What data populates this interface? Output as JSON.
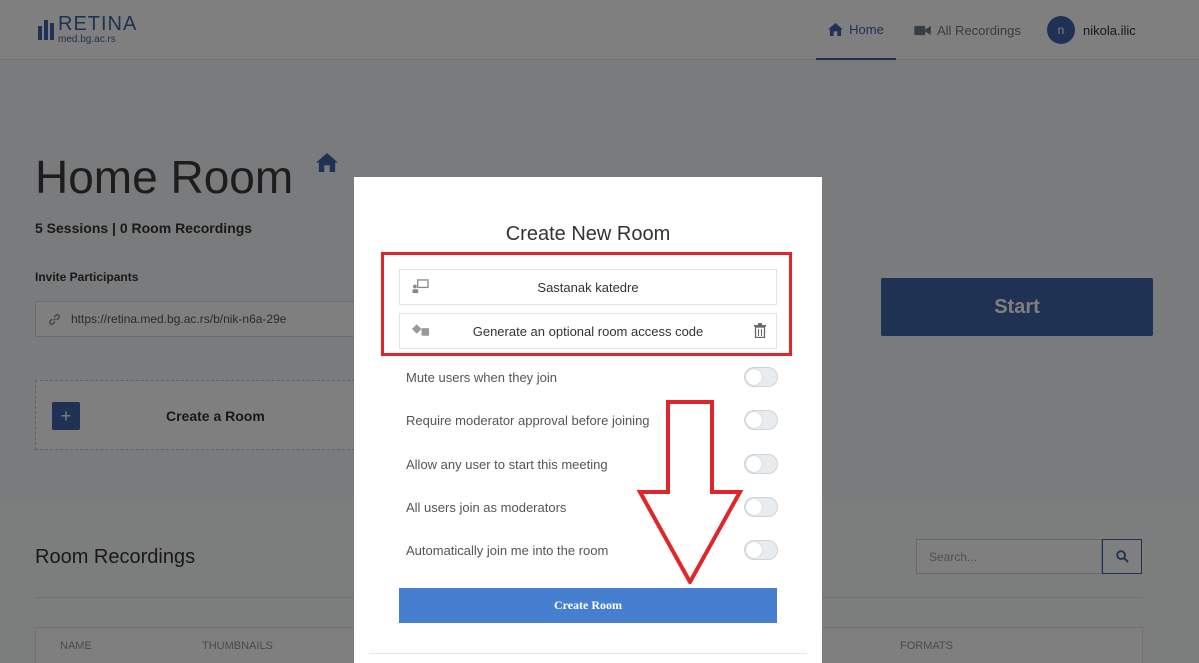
{
  "navbar": {
    "logo_title": "RETINA",
    "logo_sub": "med.bg.ac.rs",
    "home_label": "Home",
    "recordings_label": "All Recordings",
    "avatar_initial": "n",
    "username": "nikola.ilic"
  },
  "page": {
    "title": "Home Room",
    "sessions": "5 Sessions | 0 Room Recordings",
    "invite_label": "Invite Participants",
    "invite_url": "https://retina.med.bg.ac.rs/b/nik-n6a-29e",
    "create_room_card": "Create a Room",
    "plus": "+",
    "start_button": "Start"
  },
  "recordings": {
    "title": "Room Recordings",
    "search_placeholder": "Search...",
    "columns": [
      "NAME",
      "THUMBNAILS",
      "FORMATS"
    ]
  },
  "modal": {
    "title": "Create New Room",
    "room_name_value": "Sastanak katedre",
    "access_code_text": "Generate an optional room access code",
    "options": [
      {
        "label": "Mute users when they join",
        "enabled": false
      },
      {
        "label": "Require moderator approval before joining",
        "enabled": false
      },
      {
        "label": "Allow any user to start this meeting",
        "enabled": false
      },
      {
        "label": "All users join as moderators",
        "enabled": false
      },
      {
        "label": "Automatically join me into the room",
        "enabled": false
      }
    ],
    "create_button": "Create Room"
  },
  "annotation": {
    "highlight_color": "#e0262a",
    "arrow_color": "#e0262a"
  },
  "colors": {
    "primary": "#3e64a6",
    "button_blue": "#467fcf"
  }
}
